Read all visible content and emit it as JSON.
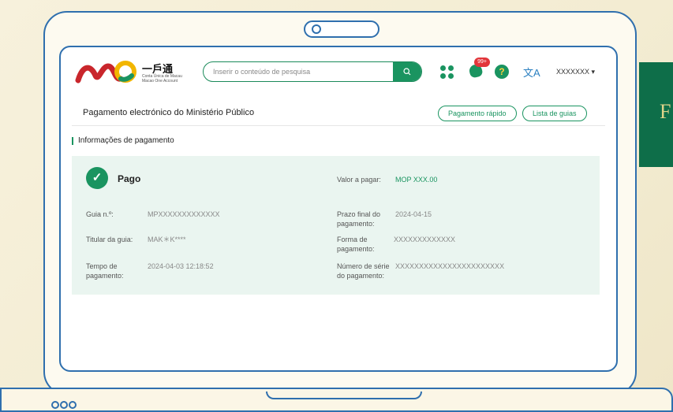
{
  "brand": {
    "cn": "一戶通",
    "pt_line1": "Conta Única de Macau",
    "pt_line2": "Macao One Account"
  },
  "search": {
    "placeholder": "Inserir o conteúdo de pesquisa"
  },
  "header": {
    "badge": "99+",
    "user": "XXXXXXX ▾",
    "lang_glyph": "文A",
    "help_glyph": "?"
  },
  "page": {
    "title": "Pagamento electrónico do Ministério Público",
    "quick_pay": "Pagamento rápido",
    "guide_list": "Lista de guias"
  },
  "section": {
    "heading": "Informações de pagamento"
  },
  "payment": {
    "status": "Pago",
    "amount_label": "Valor a pagar:",
    "amount_value": "MOP XXX.00",
    "guide_label": "Guia n.º:",
    "guide_value": "MPXXXXXXXXXXXXX",
    "deadline_label_1": "Prazo final do",
    "deadline_label_2": "pagamento:",
    "deadline_value": "2024-04-15",
    "holder_label": "Titular da guia:",
    "holder_value": "MAK＊K****",
    "method_label_1": "Forma de",
    "method_label_2": "pagamento:",
    "method_value": "XXXXXXXXXXXXX",
    "time_label_1": "Tempo de",
    "time_label_2": "pagamento:",
    "time_value": "2024-04-03 12:18:52",
    "serial_label_1": "Número de série",
    "serial_label_2": "do pagamento:",
    "serial_value": "XXXXXXXXXXXXXXXXXXXXXXX"
  },
  "banner": {
    "text": "F"
  },
  "colors": {
    "accent": "#1a9460",
    "frame": "#2f6fae",
    "panel": "#eaf5f0",
    "badge": "#e2363b",
    "banner": "#0e6e49"
  }
}
